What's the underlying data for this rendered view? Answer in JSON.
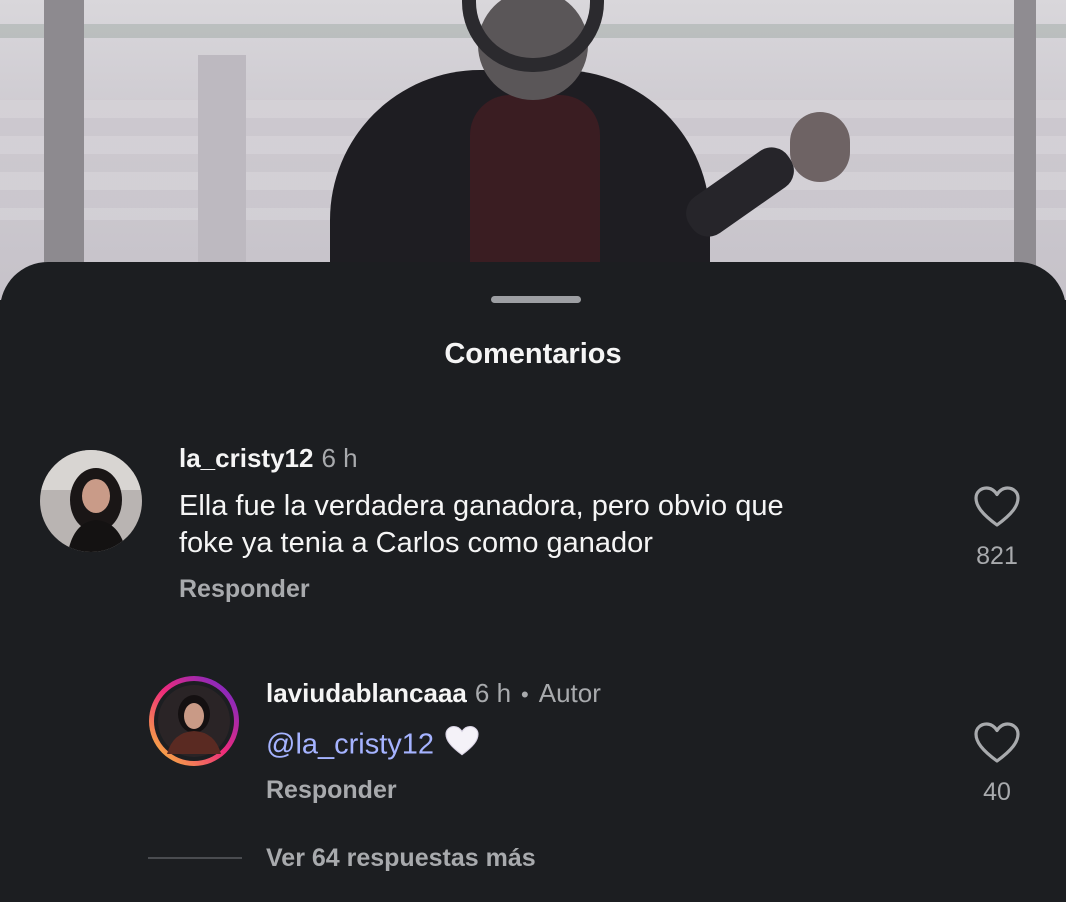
{
  "sheet": {
    "title": "Comentarios"
  },
  "comments": [
    {
      "username": "la_cristy12",
      "time": "6 h",
      "text_line1": "Ella fue la verdadera ganadora, pero obvio que",
      "text_line2": "foke ya tenia a Carlos como ganador",
      "reply_label": "Responder",
      "likes": "821",
      "like_icon": "heart-outline-icon"
    },
    {
      "username": "laviudablancaaa",
      "time": "6 h",
      "separator": "•",
      "author_label": "Autor",
      "mention": "@la_cristy12",
      "emoji": "white-heart-emoji",
      "reply_label": "Responder",
      "likes": "40",
      "like_icon": "heart-outline-icon",
      "story_ring": true
    }
  ],
  "view_more": {
    "label": "Ver 64 respuestas más"
  },
  "colors": {
    "background": "#1c1e21",
    "text_primary": "#f5f5f5",
    "text_secondary": "#a8aaad",
    "mention": "#a5b3ff",
    "story_ring_start": "#f9ce34",
    "story_ring_mid": "#ee2a7b",
    "story_ring_end": "#6228d7"
  }
}
